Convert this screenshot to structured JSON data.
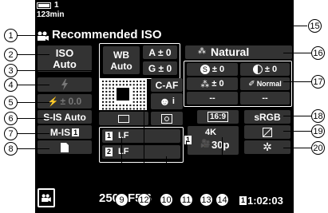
{
  "top": {
    "battery_icon": "battery-full-icon",
    "shots_count": "1",
    "record_time": "123min"
  },
  "mode_title": "Recommended ISO",
  "iso": {
    "label": "ISO",
    "value": "Auto"
  },
  "wb": {
    "label": "WB",
    "value": "Auto",
    "a_value": "A ± 0",
    "g_value": "G ± 0"
  },
  "picture_mode": {
    "icon": "picture-mode-icon",
    "value": "Natural"
  },
  "flash_mode": {
    "icon": "flash-icon"
  },
  "flash_comp": "± 0.0",
  "focus_mode": "C-AF",
  "face_priority": {
    "icon": "face-priority-icon",
    "value": "i"
  },
  "image_params": {
    "sharpness": "± 0",
    "contrast": "± 0",
    "saturation": "± 0",
    "gradation": "Normal",
    "filter": "--",
    "tone": "--"
  },
  "stabilizer": {
    "video": "S-IS Auto",
    "still_label": "M-IS",
    "still_num": "1"
  },
  "aspect": "16:9",
  "color_space": "sRGB",
  "card_icon": "card-icon",
  "rec_slot1": {
    "num": "1",
    "quality": "LF"
  },
  "rec_slot2": {
    "num": "2",
    "quality": "LF"
  },
  "movie_quality": {
    "slot": "1",
    "res": "4K",
    "fps": "30p"
  },
  "shutter": "250",
  "aperture": "F5.6",
  "remaining": "1:02:03",
  "remaining_slot": "1",
  "callouts": [
    "1",
    "2",
    "3",
    "4",
    "5",
    "6",
    "7",
    "8",
    "9",
    "10",
    "11",
    "12",
    "13",
    "14",
    "15",
    "16",
    "17",
    "18",
    "19",
    "20"
  ]
}
